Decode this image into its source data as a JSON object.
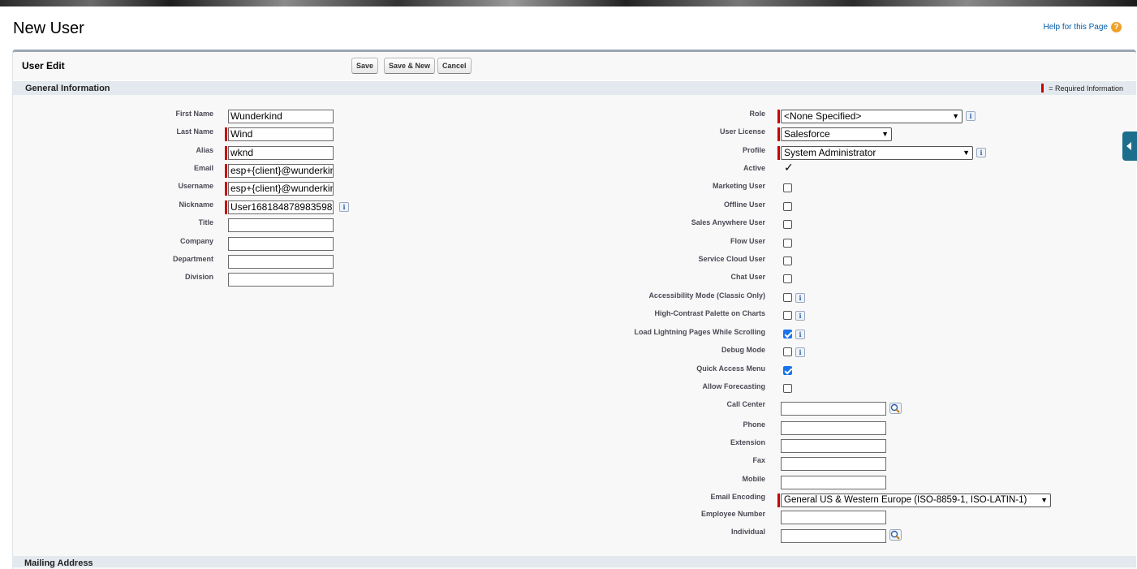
{
  "page": {
    "title": "New User",
    "help": "Help for this Page"
  },
  "panel": {
    "title": "User Edit",
    "save": "Save",
    "save_new": "Save & New",
    "cancel": "Cancel"
  },
  "section": {
    "title": "General Information",
    "required_legend": "= Required Information"
  },
  "left_fields": {
    "first_name": {
      "label": "First Name",
      "value": "Wunderkind"
    },
    "last_name": {
      "label": "Last Name",
      "value": "Wind"
    },
    "alias": {
      "label": "Alias",
      "value": "wknd"
    },
    "email": {
      "label": "Email",
      "value": "esp+{client}@wunderkin"
    },
    "username": {
      "label": "Username",
      "value": "esp+{client}@wunderkin"
    },
    "nickname": {
      "label": "Nickname",
      "value": "User168184878983598"
    },
    "title": {
      "label": "Title",
      "value": ""
    },
    "company": {
      "label": "Company",
      "value": ""
    },
    "department": {
      "label": "Department",
      "value": ""
    },
    "division": {
      "label": "Division",
      "value": ""
    }
  },
  "right_fields": {
    "role": {
      "label": "Role",
      "value": "<None Specified>"
    },
    "user_license": {
      "label": "User License",
      "value": "Salesforce"
    },
    "profile": {
      "label": "Profile",
      "value": "System Administrator"
    },
    "active": {
      "label": "Active",
      "value": "✓"
    },
    "marketing_user": {
      "label": "Marketing User",
      "checked": false
    },
    "offline_user": {
      "label": "Offline User",
      "checked": false
    },
    "sales_anywhere_user": {
      "label": "Sales Anywhere User",
      "checked": false
    },
    "flow_user": {
      "label": "Flow User",
      "checked": false
    },
    "service_cloud_user": {
      "label": "Service Cloud User",
      "checked": false
    },
    "chat_user": {
      "label": "Chat User",
      "checked": false
    },
    "accessibility_mode": {
      "label": "Accessibility Mode (Classic Only)",
      "checked": false
    },
    "high_contrast": {
      "label": "High-Contrast Palette on Charts",
      "checked": false
    },
    "load_lightning": {
      "label": "Load Lightning Pages While Scrolling",
      "checked": true
    },
    "debug_mode": {
      "label": "Debug Mode",
      "checked": false
    },
    "quick_access": {
      "label": "Quick Access Menu",
      "checked": true
    },
    "allow_forecasting": {
      "label": "Allow Forecasting",
      "checked": false
    },
    "call_center": {
      "label": "Call Center",
      "value": ""
    },
    "phone": {
      "label": "Phone",
      "value": ""
    },
    "extension": {
      "label": "Extension",
      "value": ""
    },
    "fax": {
      "label": "Fax",
      "value": ""
    },
    "mobile": {
      "label": "Mobile",
      "value": ""
    },
    "email_encoding": {
      "label": "Email Encoding",
      "value": "General US & Western Europe (ISO-8859-1, ISO-LATIN-1)"
    },
    "employee_number": {
      "label": "Employee Number",
      "value": ""
    },
    "individual": {
      "label": "Individual",
      "value": ""
    }
  },
  "next_section": {
    "title": "Mailing Address"
  },
  "icons": {
    "help": "question-circle-icon",
    "info": "info-icon",
    "lookup": "magnifier-lookup-icon",
    "side": "chevron-left-icon"
  },
  "colors": {
    "required": "#cc0000",
    "accent": "#1c6e8c",
    "checkbox": "#1a73e8",
    "help": "#f0a025"
  }
}
